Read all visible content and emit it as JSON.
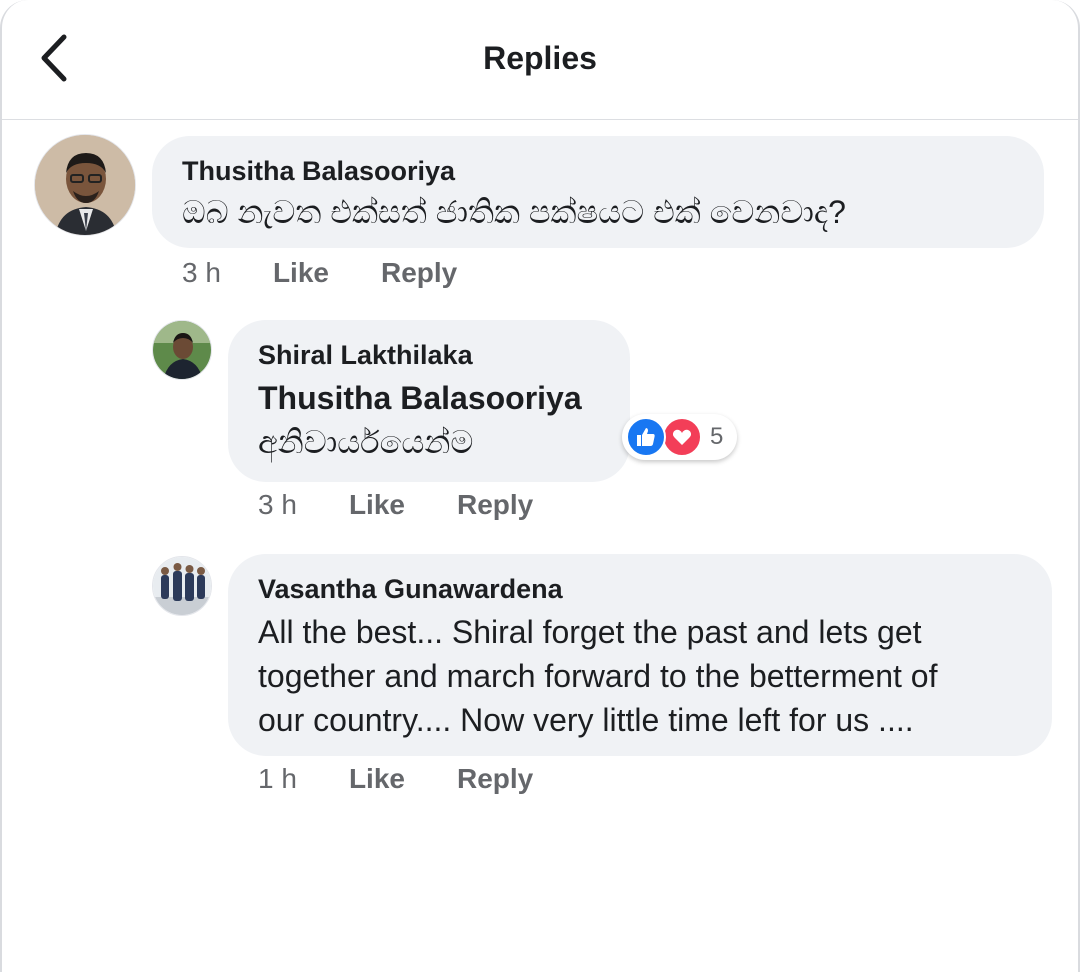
{
  "header": {
    "title": "Replies",
    "back_icon": "chevron-left-icon"
  },
  "comments": [
    {
      "author": "Thusitha Balasooriya",
      "text": "ඔබ නැවත එක්සත් ජාතික පක්ෂයට එක් වෙනවාද?",
      "time": "3 h",
      "like_label": "Like",
      "reply_label": "Reply"
    },
    {
      "author": "Shiral Lakthilaka",
      "mention": "Thusitha Balasooriya",
      "text": "අනිවාර්යයෙන්ම",
      "time": "3 h",
      "like_label": "Like",
      "reply_label": "Reply",
      "reactions": {
        "types": [
          "like-icon",
          "love-icon"
        ],
        "count": "5"
      }
    },
    {
      "author": "Vasantha Gunawardena",
      "text_lines": [
        "All the best... Shiral forget the past and lets get",
        "together and march forward to the betterment of",
        "our country.... Now very little time left for us ...."
      ],
      "time": "1 h",
      "like_label": "Like",
      "reply_label": "Reply"
    }
  ],
  "colors": {
    "bubble": "#f0f2f5",
    "like_blue": "#1877f2",
    "love_red": "#f33e58",
    "secondary_text": "#65676b"
  }
}
